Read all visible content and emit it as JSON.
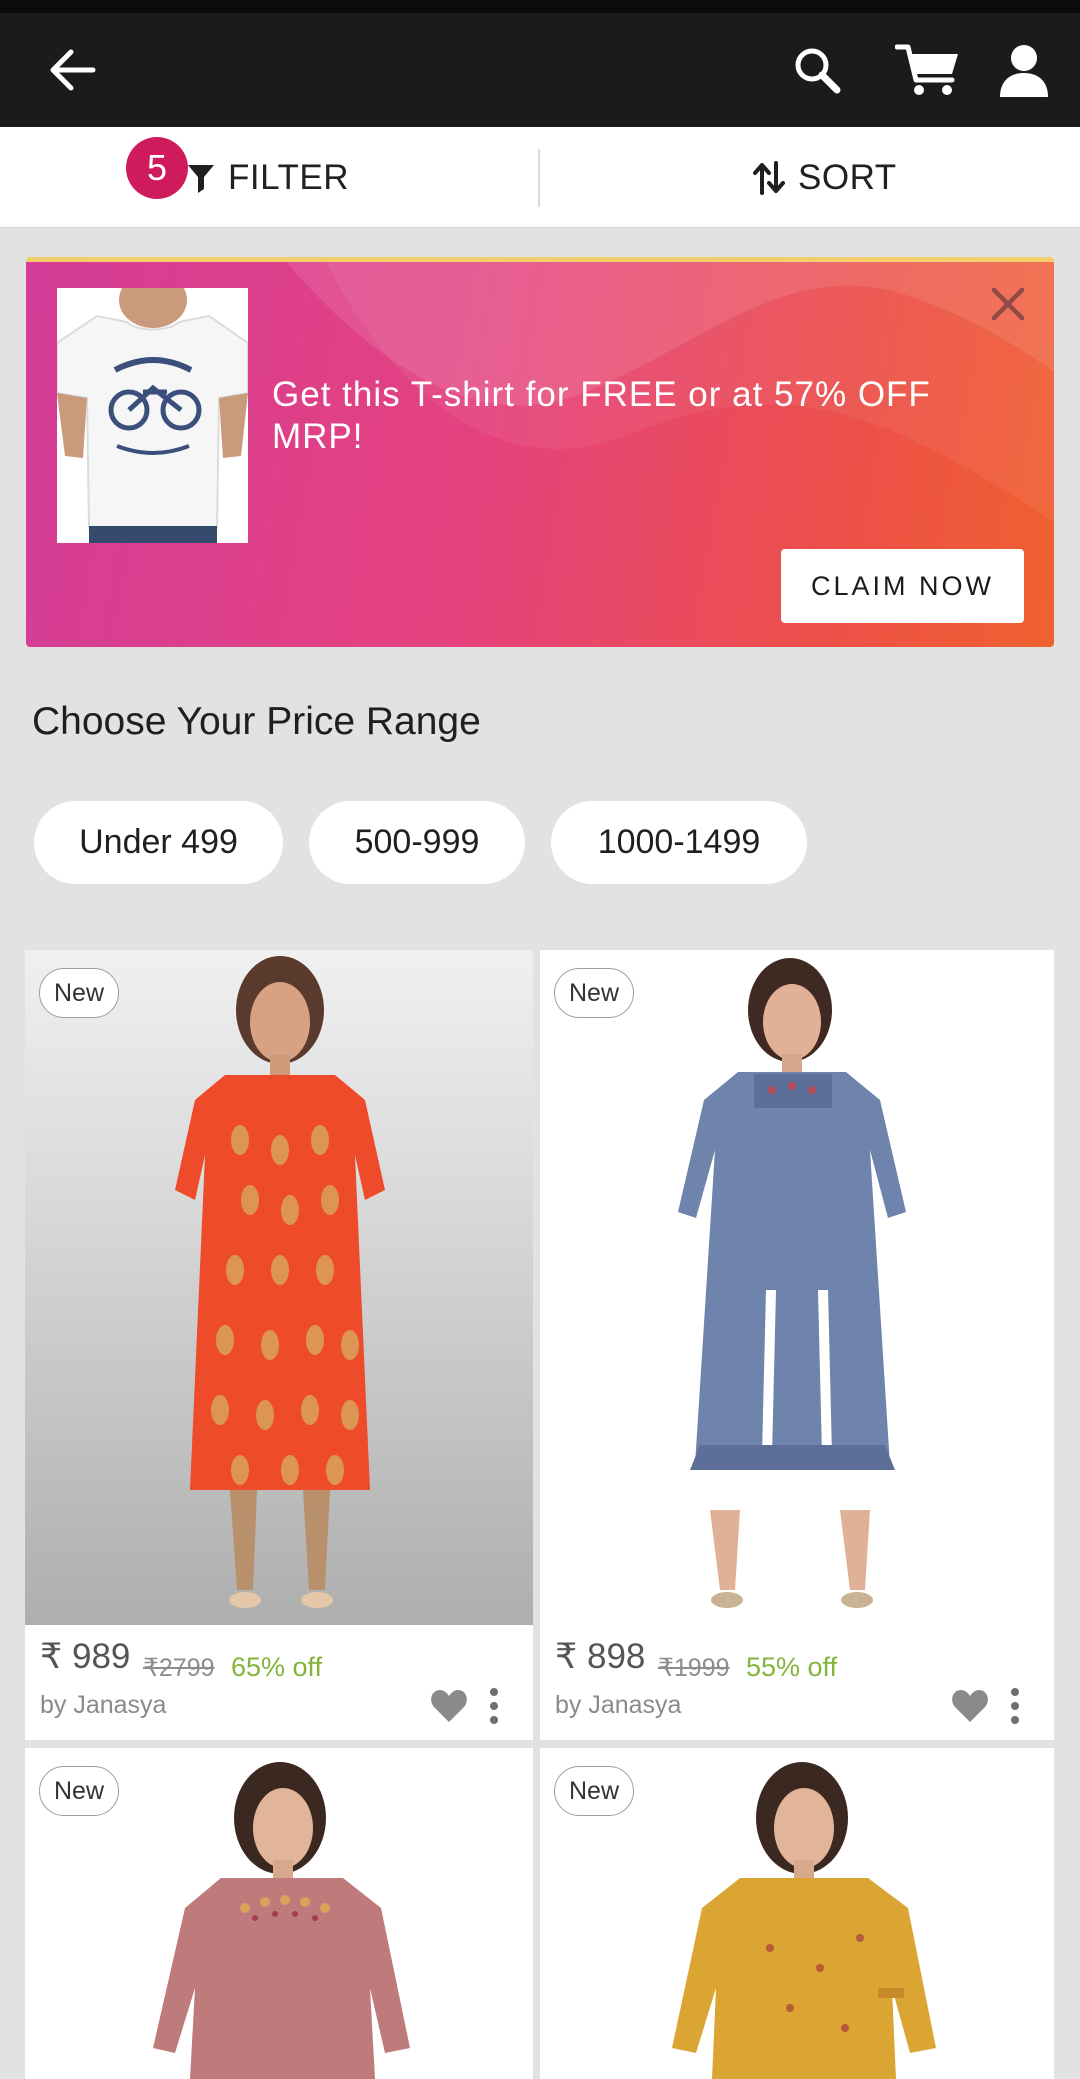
{
  "toolbar": {
    "back_icon": "arrow-left-icon",
    "search_icon": "search-icon",
    "cart_icon": "cart-icon",
    "account_icon": "user-icon"
  },
  "tabs": {
    "filter_count": "5",
    "filter_label": "FILTER",
    "sort_label": "SORT"
  },
  "promo": {
    "text": "Get this T-shirt for FREE or at 57% OFF MRP!",
    "cta_label": "CLAIM NOW"
  },
  "price_range": {
    "title": "Choose Your Price Range",
    "chips": [
      "Under 499",
      "500-999",
      "1000-1499"
    ]
  },
  "products": [
    {
      "badge": "New",
      "price": "₹ 989",
      "mrp": "₹2799",
      "discount": "65% off",
      "brand": "by Janasya",
      "color": "#ef4a2c"
    },
    {
      "badge": "New",
      "price": "₹ 898",
      "mrp": "₹1999",
      "discount": "55% off",
      "brand": "by Janasya",
      "color": "#6f84ad"
    },
    {
      "badge": "New",
      "color": "#bf7a7b"
    },
    {
      "badge": "New",
      "color": "#dba533"
    }
  ],
  "colors": {
    "appbar": "#1b1b1b",
    "badge": "#cf1a5c",
    "discount": "#83b43b"
  }
}
